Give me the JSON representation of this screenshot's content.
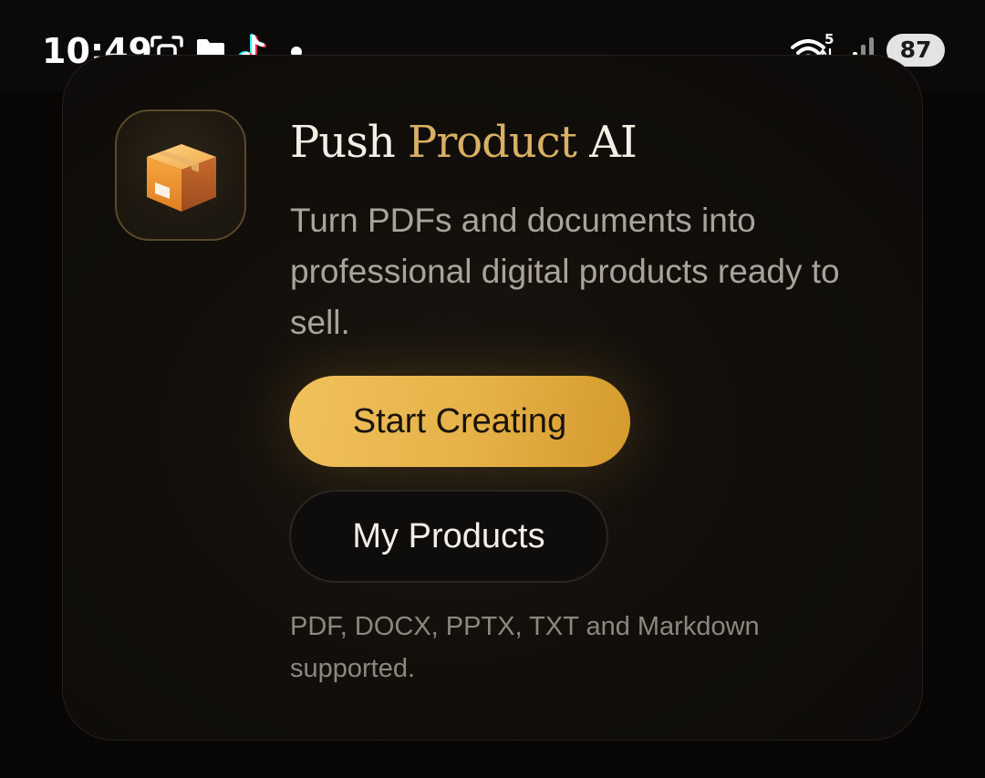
{
  "status_bar": {
    "time": "10:49",
    "wifi_badge": "5",
    "battery": "87",
    "icons": [
      "screen-record-icon",
      "folder-icon",
      "tiktok-icon",
      "dot-icon",
      "wifi-icon",
      "signal-icon",
      "battery-icon"
    ]
  },
  "card": {
    "app_icon": "package-box-icon",
    "title_part1": "Push ",
    "title_part2": "Product",
    "title_part3": " AI",
    "tagline": "Turn PDFs and documents into professional digital products ready to sell.",
    "primary_button": "Start Creating",
    "secondary_button": "My Products",
    "footnote": "PDF, DOCX, PPTX, TXT and Markdown supported."
  },
  "colors": {
    "accent": "#d9b063",
    "button_gold": "#e6b148",
    "background": "#070605"
  }
}
